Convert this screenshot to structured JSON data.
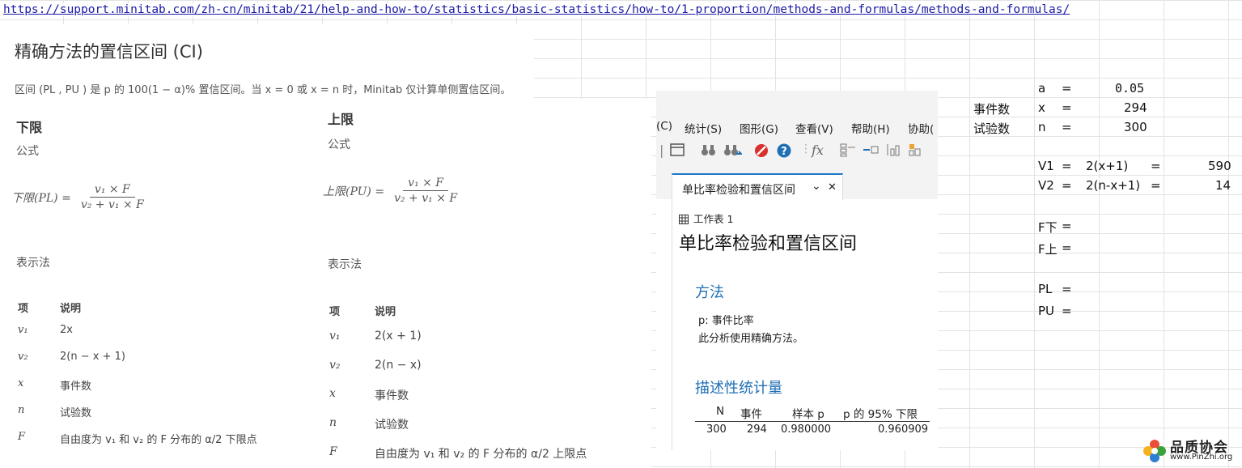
{
  "url": "https://support.minitab.com/zh-cn/minitab/21/help-and-how-to/statistics/basic-statistics/how-to/1-proportion/methods-and-formulas/methods-and-formulas/",
  "doc": {
    "title": "精确方法的置信区间 (CI)",
    "description": "区间 (PL , PU ) 是 p 的 100(1 − α)% 置信区间。当 x = 0 或 x = n 时，Minitab 仅计算单侧置信区间。",
    "lower": {
      "heading": "下限",
      "formula_label": "公式",
      "lhs": "下限(PL) =",
      "num": "v₁ × F",
      "den": "v₂ + v₁ × F",
      "notation_label": "表示法",
      "col_item": "项",
      "col_desc": "说明",
      "rows": [
        {
          "item": "v₁",
          "desc": "2x"
        },
        {
          "item": "v₂",
          "desc": "2(n − x + 1)"
        },
        {
          "item": "x",
          "desc": "事件数"
        },
        {
          "item": "n",
          "desc": "试验数"
        },
        {
          "item": "F",
          "desc": "自由度为 v₁ 和 v₂ 的 F 分布的 α/2 下限点"
        }
      ]
    },
    "upper": {
      "heading": "上限",
      "formula_label": "公式",
      "lhs": "上限(PU) =",
      "num": "v₁ × F",
      "den": "v₂ + v₁ × F",
      "notation_label": "表示法",
      "col_item": "项",
      "col_desc": "说明",
      "rows": [
        {
          "item": "v₁",
          "desc": "2(x + 1)"
        },
        {
          "item": "v₂",
          "desc": "2(n − x)"
        },
        {
          "item": "x",
          "desc": "事件数"
        },
        {
          "item": "n",
          "desc": "试验数"
        },
        {
          "item": "F",
          "desc": "自由度为 v₁ 和 v₂ 的 F 分布的 α/2 上限点"
        }
      ]
    }
  },
  "minitab": {
    "menus": [
      "(C)",
      "统计(S)",
      "图形(G)",
      "查看(V)",
      "帮助(H)",
      "协助("
    ],
    "tab_label": "单比率检验和置信区间",
    "tab_dropdown": "⌄",
    "tab_close": "✕",
    "worksheet": "工作表 1",
    "title": "单比率检验和置信区间",
    "method_heading": "方法",
    "method_line1": "p: 事件比率",
    "method_line2": "此分析使用精确方法。",
    "stats_heading": "描述性统计量",
    "stats_columns": [
      "N",
      "事件",
      "样本 p",
      "p 的 95% 下限"
    ],
    "stats_row": [
      "300",
      "294",
      "0.980000",
      "0.960909"
    ]
  },
  "sheet": {
    "a_label": "a",
    "a_eq": "=",
    "a_val": "0.05",
    "x_name": "事件数",
    "x_label": "x",
    "x_eq": "=",
    "x_val": "294",
    "n_name": "试验数",
    "n_label": "n",
    "n_eq": "=",
    "n_val": "300",
    "v1_label": "V1",
    "v1_eq": "=",
    "v1_formula": "2(x+1)",
    "v1_eq2": "=",
    "v1_val": "590",
    "v2_label": "V2",
    "v2_eq": "=",
    "v2_formula": "2(n-x+1)",
    "v2_eq2": "=",
    "v2_val": "14",
    "fl_label": "F下",
    "fl_eq": "=",
    "fu_label": "F上",
    "fu_eq": "=",
    "pl_label": "PL",
    "pl_eq": "=",
    "pu_label": "PU",
    "pu_eq": "="
  },
  "watermark": {
    "name": "品质协会",
    "site": "www.PinZhi.org"
  },
  "colors": {
    "accent": "#1f6fb5",
    "tab_border": "#1f77c8",
    "link": "#1a1aa6"
  }
}
